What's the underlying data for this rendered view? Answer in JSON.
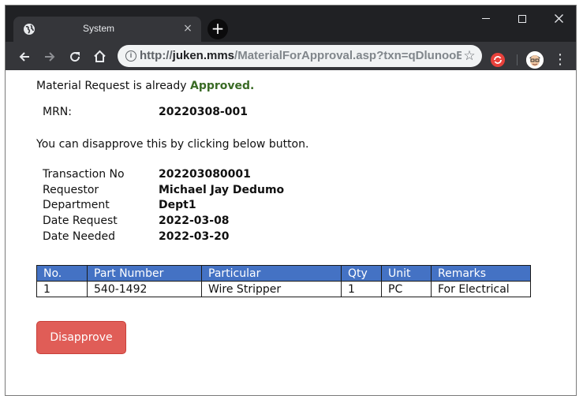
{
  "browser": {
    "tab_title": "System",
    "tab_close": "×",
    "new_tab": "+",
    "url_scheme": "http://",
    "url_host": "juken.mms",
    "url_path": "/MaterialForApproval.asp?txn=qDlunooB"
  },
  "page": {
    "status_prefix": "Material Request is already ",
    "status_word": "Approved.",
    "mrn_label": "MRN:",
    "mrn_value": "20220308-001",
    "disapprove_note": "You can disapprove this by clicking below button.",
    "details": [
      {
        "label": "Transaction No",
        "value": "202203080001"
      },
      {
        "label": "Requestor",
        "value": "Michael Jay Dedumo"
      },
      {
        "label": "Department",
        "value": "Dept1"
      },
      {
        "label": "Date Request",
        "value": "2022-03-08"
      },
      {
        "label": "Date Needed",
        "value": "2022-03-20"
      }
    ],
    "table": {
      "headers": [
        "No.",
        "Part Number",
        "Particular",
        "Qty",
        "Unit",
        "Remarks"
      ],
      "rows": [
        [
          "1",
          "540-1492",
          "Wire Stripper",
          "1",
          "PC",
          "For Electrical"
        ]
      ]
    },
    "disapprove_button": "Disapprove"
  },
  "colors": {
    "header_blue": "#4472c4",
    "approved_green": "#3a6b25",
    "button_red": "#e05d57"
  },
  "icons": [
    "globe-icon",
    "close-icon",
    "plus-icon",
    "back-arrow-icon",
    "forward-arrow-icon",
    "reload-icon",
    "home-icon",
    "info-icon",
    "star-icon",
    "extension-icon",
    "avatar",
    "menu-icon"
  ]
}
